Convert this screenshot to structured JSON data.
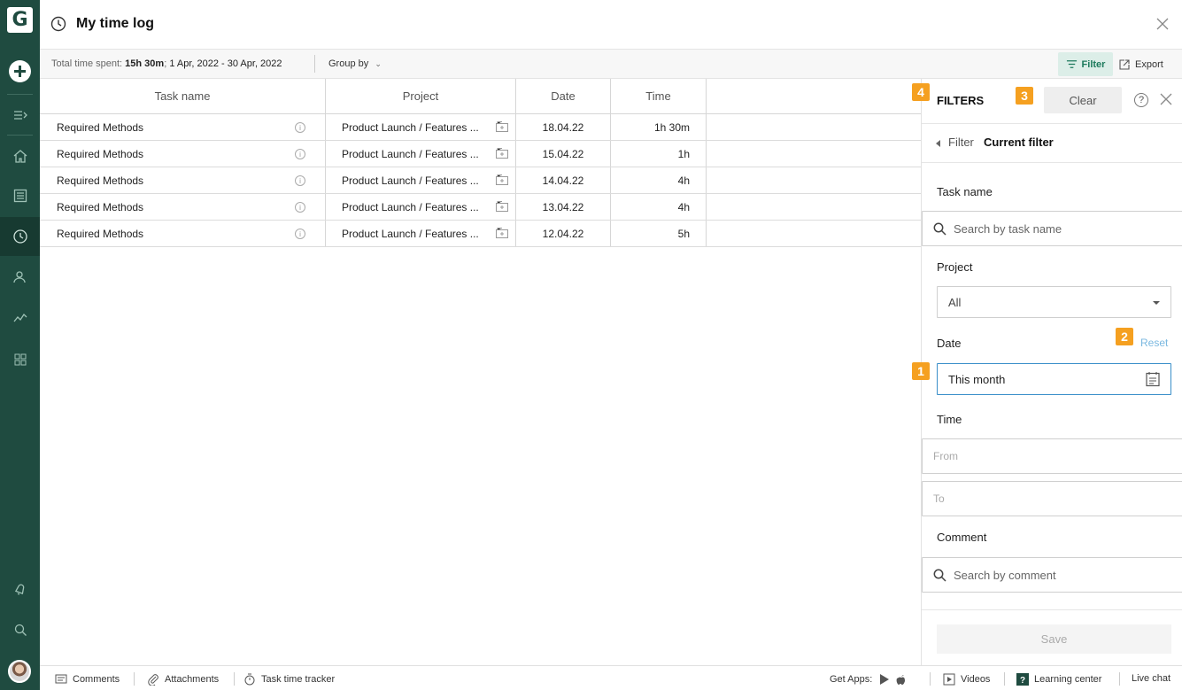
{
  "window": {
    "title": "My time log"
  },
  "toolbar": {
    "total_prefix": "Total time spent:",
    "total_value": "15h 30m",
    "total_sep": ";",
    "date_range": "1 Apr, 2022 - 30 Apr, 2022",
    "group_by": "Group by",
    "filter": "Filter",
    "export": "Export"
  },
  "table": {
    "columns": [
      "Task name",
      "Project",
      "Date",
      "Time"
    ],
    "rows": [
      {
        "task": "Required Methods",
        "project": "Product Launch / Features ...",
        "date": "18.04.22",
        "time": "1h 30m"
      },
      {
        "task": "Required Methods",
        "project": "Product Launch / Features ...",
        "date": "15.04.22",
        "time": "1h"
      },
      {
        "task": "Required Methods",
        "project": "Product Launch / Features ...",
        "date": "14.04.22",
        "time": "4h"
      },
      {
        "task": "Required Methods",
        "project": "Product Launch / Features ...",
        "date": "13.04.22",
        "time": "4h"
      },
      {
        "task": "Required Methods",
        "project": "Product Launch / Features ...",
        "date": "12.04.22",
        "time": "5h"
      }
    ]
  },
  "filters": {
    "title": "FILTERS",
    "clear": "Clear",
    "help": "?",
    "crumb_parent": "Filter",
    "crumb_current": "Current filter",
    "task_label": "Task name",
    "task_placeholder": "Search by task name",
    "project_label": "Project",
    "project_value": "All",
    "date_label": "Date",
    "date_reset": "Reset",
    "date_value": "This month",
    "time_label": "Time",
    "time_from": "From",
    "time_to": "To",
    "comment_label": "Comment",
    "comment_placeholder": "Search by comment",
    "save": "Save"
  },
  "badges": {
    "b1": "1",
    "b2": "2",
    "b3": "3",
    "b4": "4"
  },
  "footer": {
    "comments": "Comments",
    "attachments": "Attachments",
    "tracker": "Task time tracker",
    "get_apps": "Get Apps:",
    "videos": "Videos",
    "learning": "Learning center",
    "live_chat": "Live chat"
  },
  "colors": {
    "sidebar": "#1f4b40",
    "accent": "#1c7a5c",
    "badge": "#f5a020",
    "link": "#7ab8e0"
  },
  "icons": [
    "clock-icon",
    "close-icon",
    "filter-icon",
    "export-icon",
    "info-icon",
    "project-icon",
    "search-icon",
    "calendar-icon",
    "help-icon"
  ]
}
